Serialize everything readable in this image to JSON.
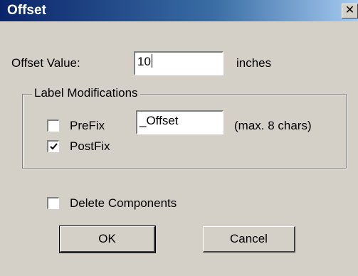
{
  "window": {
    "title": "Offset",
    "close_label": "✕"
  },
  "offset": {
    "label": "Offset Value:",
    "value": "10",
    "unit": "inches"
  },
  "label_modifications": {
    "title": "Label Modifications",
    "prefix": {
      "label": "PreFix",
      "checked": false
    },
    "postfix": {
      "label": "PostFix",
      "checked": true
    },
    "suffix_value": "_Offset",
    "hint": "(max. 8 chars)"
  },
  "delete_components": {
    "label": "Delete Components",
    "checked": false
  },
  "buttons": {
    "ok": "OK",
    "cancel": "Cancel"
  }
}
